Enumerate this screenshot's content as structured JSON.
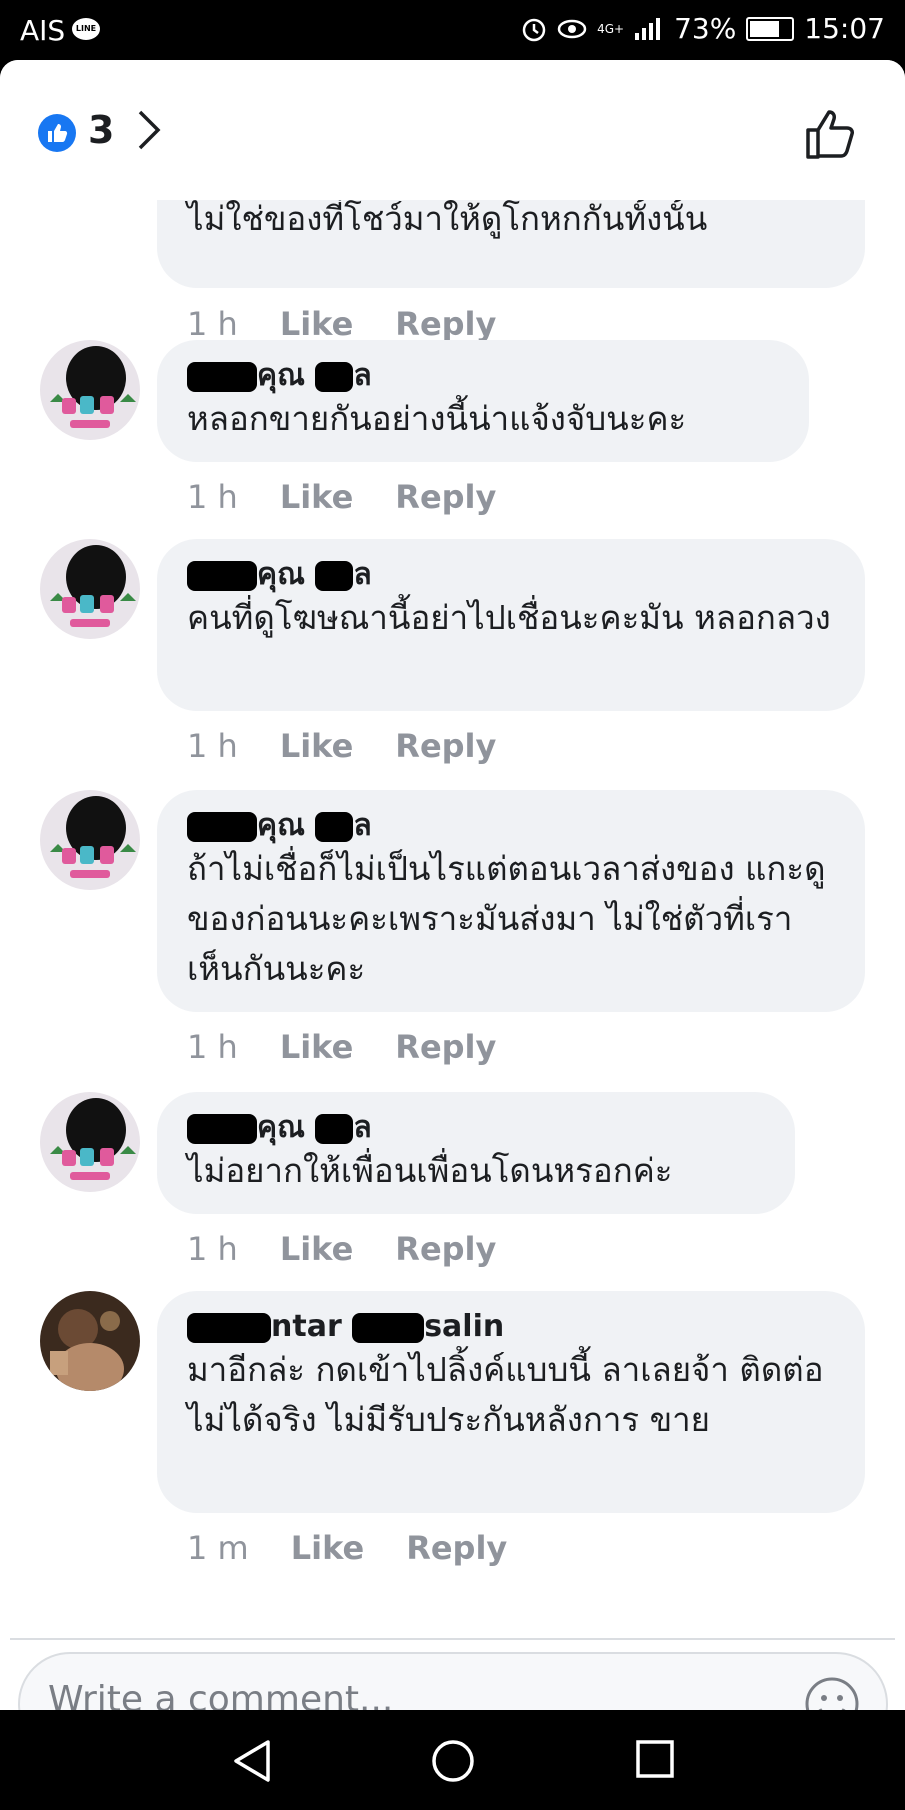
{
  "status_bar": {
    "carrier": "AIS",
    "badge": "LINE",
    "signal": "4G+",
    "battery": "73%",
    "time": "15:07"
  },
  "reactions": {
    "count": "3"
  },
  "comments": [
    {
      "author_visible": "",
      "text": "ไม่ใช่ของที่โชว์มาให้ดูโกหกกันทั้งนั้น",
      "time": "1 h",
      "like": "Like",
      "reply": "Reply"
    },
    {
      "author_visible": "คุณ",
      "author_suffix": "ล",
      "text": "หลอกขายกันอย่างนี้น่าแจ้งจับนะคะ",
      "time": "1 h",
      "like": "Like",
      "reply": "Reply"
    },
    {
      "author_visible": "คุณ",
      "author_suffix": "ล",
      "text": "คนที่ดูโฆษณานี้อย่าไปเชื่อนะคะมัน หลอกลวง",
      "time": "1 h",
      "like": "Like",
      "reply": "Reply"
    },
    {
      "author_visible": "คุณ",
      "author_suffix": "ล",
      "text": "ถ้าไม่เชื่อก็ไม่เป็นไรแต่ตอนเวลาส่งของ แกะดูของก่อนนะคะเพราะมันส่งมา ไม่ใช่ตัวที่เราเห็นกันนะคะ",
      "time": "1 h",
      "like": "Like",
      "reply": "Reply"
    },
    {
      "author_visible": "คุณ",
      "author_suffix": "ล",
      "text": "ไม่อยากให้เพื่อนเพื่อนโดนหรอกค่ะ",
      "time": "1 h",
      "like": "Like",
      "reply": "Reply"
    },
    {
      "author_visible": "ntar",
      "author_suffix": "salin",
      "text": "มาอีกล่ะ กดเข้าไปลิ้งค์แบบนี้ ลาเลยจ้า ติดต่อไม่ได้จริง ไม่มีรับประกันหลังการ ขาย",
      "time": "1 m",
      "like": "Like",
      "reply": "Reply"
    }
  ],
  "composer": {
    "placeholder": "Write a comment..."
  },
  "colors": {
    "accent": "#1877f2",
    "bubble": "#f0f2f5",
    "meta": "#90949c"
  }
}
